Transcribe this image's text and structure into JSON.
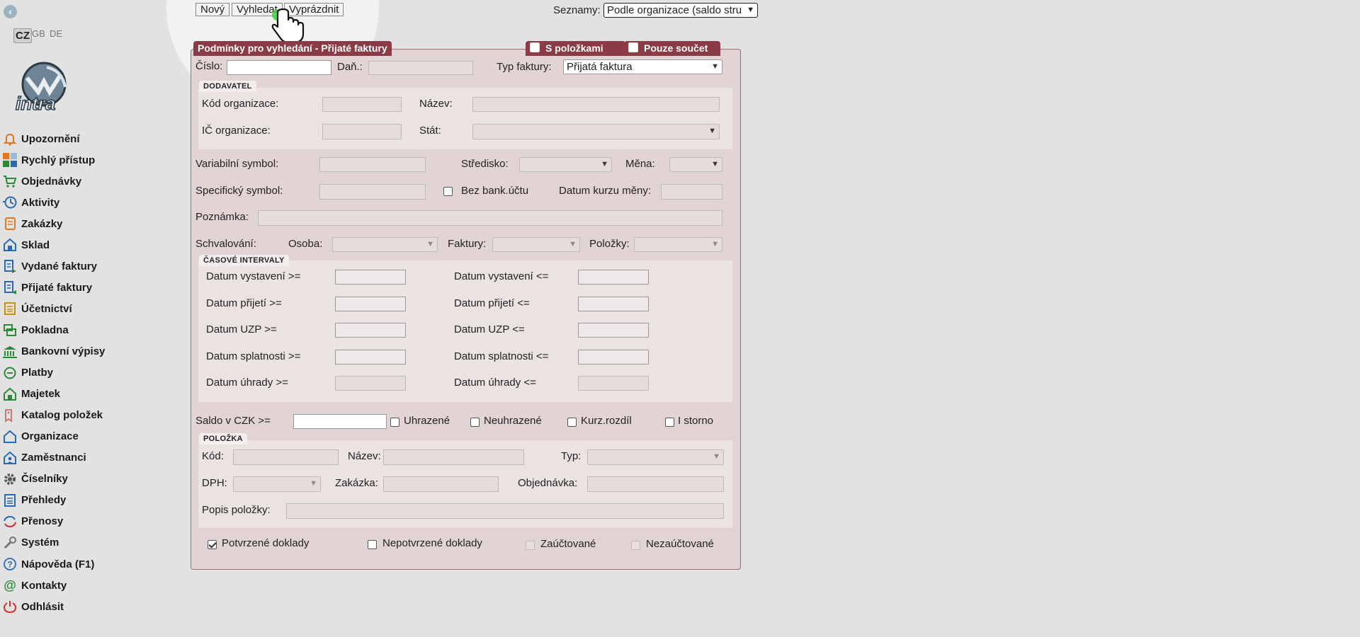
{
  "lang": {
    "cz": "CZ",
    "gb": "GB",
    "de": "DE"
  },
  "logo_text": "intra",
  "sidebar": {
    "items": [
      {
        "label": "Upozornění",
        "icon": "bell-icon"
      },
      {
        "label": "Rychlý přístup",
        "icon": "tiles-icon"
      },
      {
        "label": "Objednávky",
        "icon": "cart-icon"
      },
      {
        "label": "Aktivity",
        "icon": "clock-icon"
      },
      {
        "label": "Zakázky",
        "icon": "clipboard-icon"
      },
      {
        "label": "Sklad",
        "icon": "warehouse-icon"
      },
      {
        "label": "Vydané faktury",
        "icon": "invoice-out-icon"
      },
      {
        "label": "Přijaté faktury",
        "icon": "invoice-in-icon"
      },
      {
        "label": "Účetnictví",
        "icon": "ledger-icon"
      },
      {
        "label": "Pokladna",
        "icon": "cash-icon"
      },
      {
        "label": "Bankovní výpisy",
        "icon": "bank-icon"
      },
      {
        "label": "Platby",
        "icon": "payments-icon"
      },
      {
        "label": "Majetek",
        "icon": "property-icon"
      },
      {
        "label": "Katalog položek",
        "icon": "tag-icon"
      },
      {
        "label": "Organizace",
        "icon": "organization-icon"
      },
      {
        "label": "Zaměstnanci",
        "icon": "employees-icon"
      },
      {
        "label": "Číselníky",
        "icon": "gear-icon"
      },
      {
        "label": "Přehledy",
        "icon": "list-icon"
      },
      {
        "label": "Přenosy",
        "icon": "sync-icon"
      },
      {
        "label": "Systém",
        "icon": "wrench-icon"
      },
      {
        "label": "Nápověda (F1)",
        "icon": "help-icon"
      },
      {
        "label": "Kontakty",
        "icon": "at-icon"
      },
      {
        "label": "Odhlásit",
        "icon": "power-icon"
      }
    ]
  },
  "toolbar": {
    "new": "Nový",
    "search": "Vyhledat",
    "clear": "Vyprázdnit",
    "lists_label": "Seznamy:",
    "lists_value": "Podle organizace (saldo stru"
  },
  "panel": {
    "title": "Podmínky pro vyhledání - Přijaté faktury",
    "with_items": "S položkami",
    "sum_only": "Pouze součet",
    "number_label": "Číslo:",
    "tax_label": "Daň.:",
    "invoice_type_label": "Typ faktury:",
    "invoice_type_value": "Přijatá faktura",
    "supplier": {
      "title": "DODAVATEL",
      "org_code": "Kód organizace:",
      "name": "Název:",
      "org_id": "IČ organizace:",
      "country": "Stát:"
    },
    "var_symbol": "Variabilní symbol:",
    "center": "Středisko:",
    "currency": "Měna:",
    "spec_symbol": "Specifický symbol:",
    "no_bank_account": "Bez bank.účtu",
    "rate_date": "Datum kurzu měny:",
    "note": "Poznámka:",
    "approval": "Schvalování:",
    "person": "Osoba:",
    "invoices": "Faktury:",
    "items": "Položky:",
    "intervals": {
      "title": "ČASOVÉ INTERVALY",
      "rows": [
        {
          "from": "Datum vystavení >=",
          "to": "Datum vystavení <="
        },
        {
          "from": "Datum přijetí >=",
          "to": "Datum přijetí <="
        },
        {
          "from": "Datum UZP >=",
          "to": "Datum UZP <="
        },
        {
          "from": "Datum splatnosti >=",
          "to": "Datum splatnosti <="
        },
        {
          "from": "Datum úhrady >=",
          "to": "Datum úhrady <="
        }
      ]
    },
    "balance_label": "Saldo v CZK >=",
    "paid": "Uhrazené",
    "unpaid": "Neuhrazené",
    "rate_diff": "Kurz.rozdíl",
    "storno": "I storno",
    "item": {
      "title": "POLOŽKA",
      "code": "Kód:",
      "name": "Název:",
      "type": "Typ:",
      "vat": "DPH:",
      "job": "Zakázka:",
      "order": "Objednávka:",
      "desc": "Popis položky:"
    },
    "confirmed": "Potvrzené doklady",
    "unconfirmed": "Nepotvrzené doklady",
    "posted": "Zaúčtované",
    "unposted": "Nezaúčtované"
  }
}
